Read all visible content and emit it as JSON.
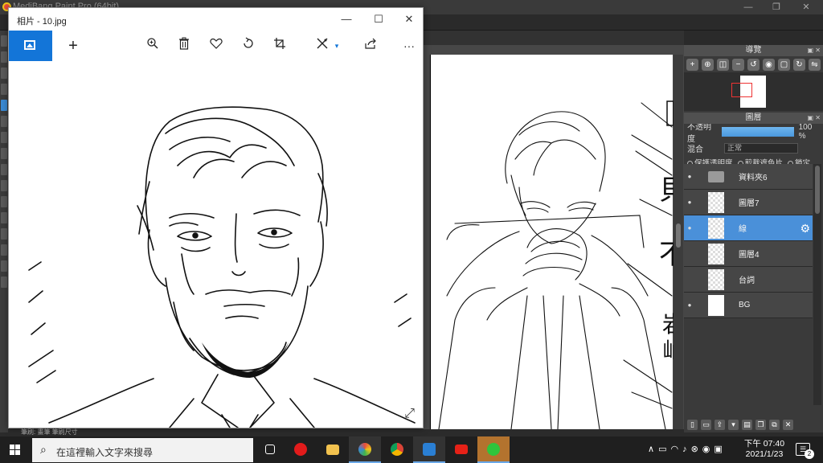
{
  "background_app": {
    "title": "MediBang Paint Pro (64bit)",
    "navigator": {
      "title": "導覽"
    },
    "layers": {
      "title": "圖層",
      "opacity_label": "不透明度",
      "opacity_value": "100 %",
      "blend_label": "混合",
      "blend_value": "正常",
      "options": [
        "保護透明度",
        "剪裁遮色片",
        "鎖定"
      ],
      "items": [
        {
          "name": "資料夾6",
          "type": "folder",
          "visible": true,
          "selected": false
        },
        {
          "name": "圖層7",
          "type": "layer",
          "visible": true,
          "selected": false
        },
        {
          "name": "線",
          "type": "layer",
          "visible": true,
          "selected": true
        },
        {
          "name": "圖層4",
          "type": "layer",
          "visible": false,
          "selected": false
        },
        {
          "name": "台詞",
          "type": "layer",
          "visible": false,
          "selected": false
        },
        {
          "name": "BG",
          "type": "layer",
          "visible": true,
          "selected": false
        }
      ]
    },
    "status_text": "筆刷: 畫筆  筆刷尺寸"
  },
  "photos": {
    "title": "相片 - 10.jpg",
    "toolbar": {
      "home": "picture-icon",
      "add": "+",
      "zoom": "zoom-icon",
      "delete": "trash-icon",
      "favorite": "heart-icon",
      "rotate": "rotate-icon",
      "crop": "crop-icon",
      "edit": "edit-icon",
      "share": "share-icon",
      "more": "···"
    }
  },
  "taskbar": {
    "search_placeholder": "在這裡輸入文字來搜尋",
    "time": "下午 07:40",
    "date": "2021/1/23",
    "notification_count": "2",
    "apps": [
      "task-view",
      "netease-music",
      "file-explorer",
      "medibang",
      "chrome",
      "photos",
      "youtube",
      "line"
    ]
  },
  "colors": {
    "accent": "#1375d8",
    "selected_layer": "#4a90d9",
    "taskbar": "#1f1f1f"
  }
}
